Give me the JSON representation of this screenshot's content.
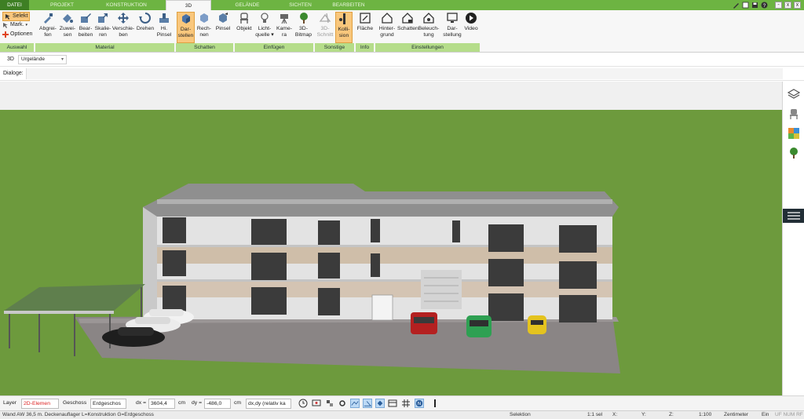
{
  "tabs": [
    {
      "label": "DATEI"
    },
    {
      "label": "PROJEKT"
    },
    {
      "label": "KONSTRUKTION"
    },
    {
      "label": "3D"
    },
    {
      "label": "GELÄNDE"
    },
    {
      "label": "SICHTEN"
    },
    {
      "label": "BEARBEITEN"
    }
  ],
  "active_tab": "3D",
  "window_controls": [
    "-",
    "x",
    "x"
  ],
  "ribbon": {
    "auswahl": {
      "items": [
        "Selekt",
        "Mark.",
        "Optionen"
      ],
      "group": "Auswahl"
    },
    "material": {
      "buttons": [
        {
          "l1": "Abgrei-",
          "l2": "fen"
        },
        {
          "l1": "Zuwei-",
          "l2": "sen"
        },
        {
          "l1": "Bear-",
          "l2": "beiten"
        },
        {
          "l1": "Skalie-",
          "l2": "ren"
        },
        {
          "l1": "Verschie-",
          "l2": "ben"
        },
        {
          "l1": "Drehen",
          "l2": ""
        },
        {
          "l1": "Hi.",
          "l2": "Pinsel"
        }
      ],
      "group": "Material"
    },
    "schatten": {
      "buttons": [
        {
          "l1": "Dar-",
          "l2": "stellen"
        },
        {
          "l1": "Rech-",
          "l2": "nen"
        },
        {
          "l1": "Pinsel",
          "l2": ""
        }
      ],
      "group": "Schatten"
    },
    "einfuegen": {
      "buttons": [
        {
          "l1": "Objekt",
          "l2": ""
        },
        {
          "l1": "Licht-",
          "l2": "quelle ▾"
        },
        {
          "l1": "Kame-",
          "l2": "ra"
        },
        {
          "l1": "3D-",
          "l2": "Bitmap"
        }
      ],
      "group": "Einfügen"
    },
    "sonstige": {
      "buttons": [
        {
          "l1": "3D-",
          "l2": "Schnitt"
        },
        {
          "l1": "Kolli-",
          "l2": "sion"
        }
      ],
      "group": "Sonstige"
    },
    "info": {
      "buttons": [
        {
          "l1": "Fläche",
          "l2": ""
        }
      ],
      "group": "Info"
    },
    "einstellungen": {
      "buttons": [
        {
          "l1": "Hinter-",
          "l2": "grund"
        },
        {
          "l1": "Schatten",
          "l2": ""
        },
        {
          "l1": "Beleuch-",
          "l2": "tung"
        },
        {
          "l1": "Dar-",
          "l2": "stellung"
        },
        {
          "l1": "Video",
          "l2": ""
        }
      ],
      "group": "Einstellungen"
    }
  },
  "view_bar": {
    "label": "3D",
    "terrain_select": "Urgelände"
  },
  "dialog_bar": {
    "label": "Dialoge:"
  },
  "bottom_toolbar": {
    "layer_label": "Layer",
    "layer_value": "2D-Elemen",
    "floor_label": "Geschoss",
    "floor_value": "Erdgeschos",
    "dx_label": "dx =",
    "dx_value": "3604,4",
    "dx_unit": "cm",
    "dy_label": "dy =",
    "dy_value": "-486,0",
    "dy_unit": "cm",
    "mode_value": "dx,dy (relativ ka"
  },
  "status_bar": {
    "message": "Wand AW 36,5 m. Deckenauflager L=Konstruktion G=Erdgeschoss",
    "mode": "Selektion",
    "selection": "1:1 sel",
    "x_label": "X:",
    "y_label": "Y:",
    "z_label": "Z:",
    "scale": "1:100",
    "unit": "Zentimeter",
    "state": "Ein",
    "flags": "UF NUM RF"
  },
  "colors": {
    "tab_green": "#6db442",
    "ribbon_group": "#b5dd8a",
    "selected_button": "#f9c77c",
    "lawn": "#6d9a3d",
    "paving": "#8a8585"
  }
}
